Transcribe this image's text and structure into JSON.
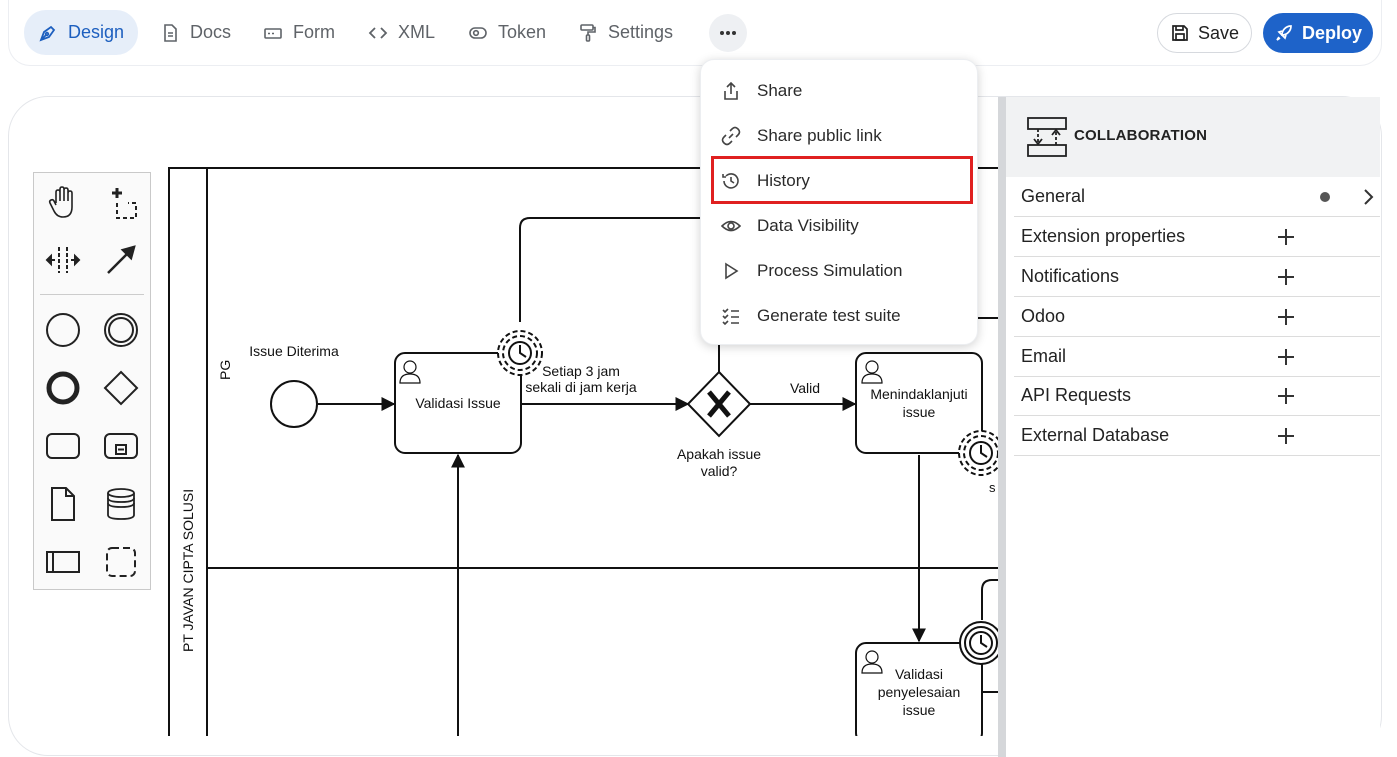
{
  "toolbar": {
    "tabs": [
      {
        "label": "Design",
        "icon": "pen-tool-icon"
      },
      {
        "label": "Docs",
        "icon": "document-icon"
      },
      {
        "label": "Form",
        "icon": "form-icon"
      },
      {
        "label": "XML",
        "icon": "code-icon"
      },
      {
        "label": "Token",
        "icon": "toggle-icon"
      },
      {
        "label": "Settings",
        "icon": "paint-roller-icon"
      }
    ],
    "more_icon": "ellipsis-icon",
    "save_label": "Save",
    "deploy_label": "Deploy"
  },
  "menu": {
    "items": [
      {
        "label": "Share",
        "icon": "share-icon"
      },
      {
        "label": "Share public link",
        "icon": "link-icon"
      },
      {
        "label": "History",
        "icon": "history-icon"
      },
      {
        "label": "Data Visibility",
        "icon": "eye-icon"
      },
      {
        "label": "Process Simulation",
        "icon": "play-icon"
      },
      {
        "label": "Generate test suite",
        "icon": "checklist-icon"
      }
    ],
    "highlighted": "History",
    "highlight_color": "#e02020"
  },
  "diagram": {
    "pool_label": "PT JAVAN CIPTA SOLUSI",
    "lane_label": "PG",
    "start_event_label": "Issue Diterima",
    "task_validasi": "Validasi Issue",
    "timer_label_line1": "Setiap 3 jam",
    "timer_label_line2": "sekali di jam kerja",
    "gateway_label_line1": "Apakah issue",
    "gateway_label_line2": "valid?",
    "flow_valid": "Valid",
    "task_tindak_line1": "Menindaklanjuti",
    "task_tindak_line2": "issue",
    "truncated_label": "s",
    "task_penyelesaian_line1": "Validasi",
    "task_penyelesaian_line2": "penyelesaian",
    "task_penyelesaian_line3": "issue"
  },
  "palette": {
    "tools": [
      "hand-tool-icon",
      "lasso-tool-icon",
      "space-tool-icon",
      "connect-tool-icon",
      "start-event-icon",
      "intermediate-event-icon",
      "end-event-icon",
      "gateway-icon",
      "task-icon",
      "subprocess-icon",
      "data-object-icon",
      "data-store-icon",
      "participant-icon",
      "group-icon"
    ]
  },
  "panel": {
    "title": "COLLABORATION",
    "icon": "collaboration-icon",
    "groups": [
      {
        "label": "General"
      },
      {
        "label": "Extension properties"
      },
      {
        "label": "Notifications"
      },
      {
        "label": "Odoo"
      },
      {
        "label": "Email"
      },
      {
        "label": "API Requests"
      },
      {
        "label": "External Database"
      }
    ]
  },
  "colors": {
    "accent": "#1e63c9",
    "active_tab_bg": "#e6eef9"
  }
}
